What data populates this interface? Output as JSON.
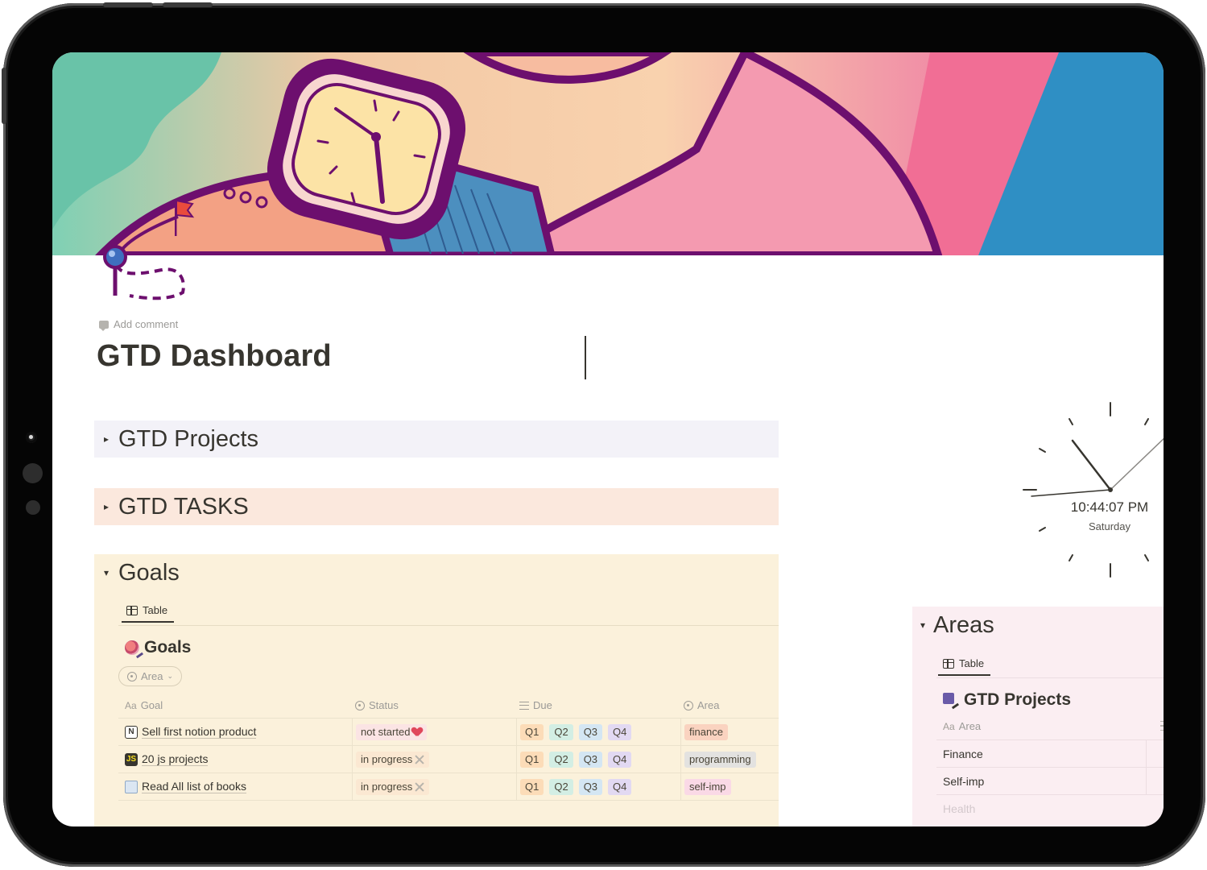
{
  "page": {
    "add_comment": "Add comment",
    "title": "GTD Dashboard"
  },
  "toggles": {
    "projects": "GTD Projects",
    "tasks": "GTD TASKS",
    "goals": "Goals"
  },
  "goals_db": {
    "view_tab": "Table",
    "title": "Goals",
    "filter_label": "Area",
    "columns": [
      "Goal",
      "Status",
      "Due",
      "Area"
    ],
    "rows": [
      {
        "goal": "Sell first notion product",
        "icon": "notion-icon",
        "status": "not started",
        "status_icon": "broken-heart-icon",
        "due": [
          "Q1",
          "Q2",
          "Q3",
          "Q4"
        ],
        "area": "finance"
      },
      {
        "goal": "20 js projects",
        "icon": "js-icon",
        "status": "in progress",
        "status_icon": "cross-icon",
        "due": [
          "Q1",
          "Q2",
          "Q3",
          "Q4"
        ],
        "area": "programming"
      },
      {
        "goal": "Read All list of books",
        "icon": "book-icon",
        "status": "in progress",
        "status_icon": "cross-icon",
        "due": [
          "Q1",
          "Q2",
          "Q3",
          "Q4"
        ],
        "area": "self-imp"
      }
    ]
  },
  "clock": {
    "time": "10:44:07 PM",
    "day": "Saturday"
  },
  "areas": {
    "heading": "Areas",
    "view_tab": "Table",
    "db_title": "GTD Projects",
    "column": "Area",
    "rows": [
      "Finance",
      "Self-imp",
      "Health"
    ]
  },
  "colors": {
    "projects_bg": "#f3f2f8",
    "tasks_bg": "#fbe8dd",
    "goals_bg": "#fbf1db",
    "areas_bg": "#fbeef2",
    "frame": "#050505"
  }
}
